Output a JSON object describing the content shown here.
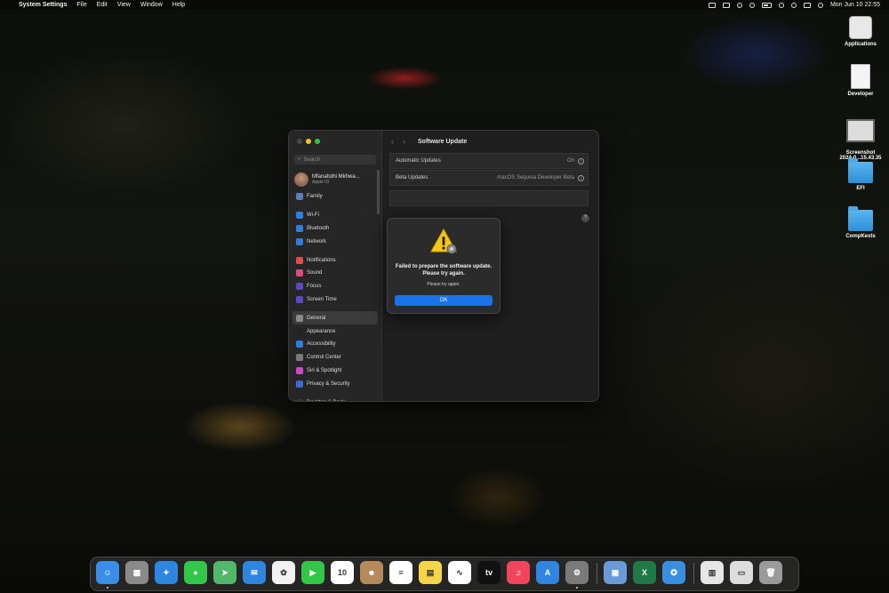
{
  "menubar": {
    "app_name": "System Settings",
    "menus": [
      "File",
      "Edit",
      "View",
      "Window",
      "Help"
    ],
    "clock": "Mon Jun 10  22:55"
  },
  "desktop_icons": [
    {
      "label": "Applications",
      "kind": "applications"
    },
    {
      "label": "Developer",
      "kind": "document"
    },
    {
      "label": "Screenshot\n2024-0...15.43.35",
      "kind": "screenshot"
    },
    {
      "label": "EFI",
      "kind": "folder"
    },
    {
      "label": "CompKexts",
      "kind": "folder"
    }
  ],
  "settings": {
    "search_placeholder": "Search",
    "profile_name": "Mfanafuthi Mkhwa...",
    "profile_sub": "Apple ID",
    "nav_items": [
      {
        "label": "Family",
        "color": "#5a7cc9"
      },
      {
        "label": "Wi-Fi",
        "color": "#2f7de1",
        "gap": true
      },
      {
        "label": "Bluetooth",
        "color": "#2f7de1"
      },
      {
        "label": "Network",
        "color": "#2f7de1"
      },
      {
        "label": "Notifications",
        "color": "#e34a4a",
        "gap": true
      },
      {
        "label": "Sound",
        "color": "#e34a7a"
      },
      {
        "label": "Focus",
        "color": "#5a4ac9"
      },
      {
        "label": "Screen Time",
        "color": "#5a4ac9"
      },
      {
        "label": "General",
        "color": "#8a8a8a",
        "gap": true,
        "selected": true
      },
      {
        "label": "Appearance",
        "color": "#222222"
      },
      {
        "label": "Accessibility",
        "color": "#2f7de1"
      },
      {
        "label": "Control Center",
        "color": "#7a7a7a"
      },
      {
        "label": "Siri & Spotlight",
        "color": "#c94ac9"
      },
      {
        "label": "Privacy & Security",
        "color": "#3a6ad9"
      },
      {
        "label": "Desktop & Dock",
        "color": "#3a3a3a",
        "gap": true
      }
    ],
    "page_title": "Software Update",
    "rows": [
      {
        "label": "Automatic Updates",
        "value": "On"
      },
      {
        "label": "Beta Updates",
        "value": "macOS Sequoia Developer Beta"
      }
    ],
    "help_label": "?"
  },
  "alert": {
    "title": "Failed to prepare the software update. Please try again.",
    "message": "Please try again.",
    "ok_label": "OK"
  },
  "dock": [
    {
      "name": "Finder",
      "color": "#3b8ee8",
      "glyph": "☺",
      "running": true
    },
    {
      "name": "Launchpad",
      "color": "#8a8a8a",
      "glyph": "▦"
    },
    {
      "name": "Safari",
      "color": "#2f86e0",
      "glyph": "✦"
    },
    {
      "name": "Messages",
      "color": "#33c74a",
      "glyph": "●"
    },
    {
      "name": "Maps",
      "color": "#4fb86a",
      "glyph": "➤"
    },
    {
      "name": "Mail",
      "color": "#2f86e0",
      "glyph": "✉"
    },
    {
      "name": "Photos",
      "color": "#f2f2f2",
      "glyph": "✿"
    },
    {
      "name": "FaceTime",
      "color": "#33c74a",
      "glyph": "▶"
    },
    {
      "name": "Calendar",
      "color": "#ffffff",
      "glyph": "10",
      "sub": "JUN"
    },
    {
      "name": "Contacts",
      "color": "#b58a5a",
      "glyph": "☻"
    },
    {
      "name": "Reminders",
      "color": "#ffffff",
      "glyph": "≡"
    },
    {
      "name": "Notes",
      "color": "#f7d54a",
      "glyph": "▤"
    },
    {
      "name": "Freeform",
      "color": "#ffffff",
      "glyph": "∿"
    },
    {
      "name": "Apple TV",
      "color": "#111111",
      "glyph": "tv"
    },
    {
      "name": "Music",
      "color": "#f0455a",
      "glyph": "♫"
    },
    {
      "name": "App Store",
      "color": "#2f86e0",
      "glyph": "A"
    },
    {
      "name": "System Settings",
      "color": "#7a7a7a",
      "glyph": "⚙",
      "running": true
    },
    {
      "name": "Preview",
      "color": "#6a9ad8",
      "glyph": "▣",
      "sep_before": true
    },
    {
      "name": "Excel",
      "color": "#1e7a45",
      "glyph": "X"
    },
    {
      "name": "Xcode Helper",
      "color": "#3a8ee0",
      "glyph": "✪"
    },
    {
      "name": "Document",
      "color": "#e6e6e6",
      "glyph": "▥",
      "sep_before": true
    },
    {
      "name": "Screenshot",
      "color": "#dddddd",
      "glyph": "▭"
    },
    {
      "name": "Trash",
      "color": "#9a9a9a",
      "glyph": "🗑"
    }
  ]
}
